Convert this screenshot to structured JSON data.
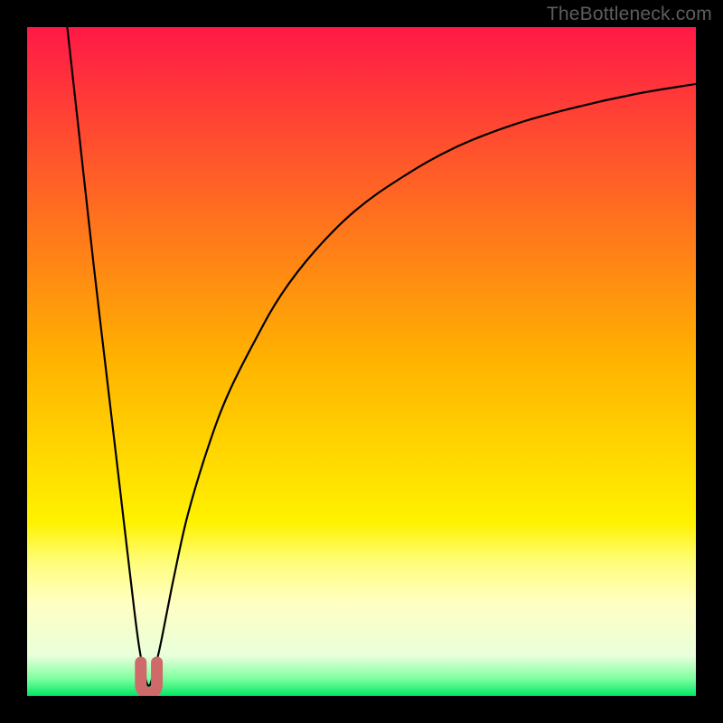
{
  "watermark": "TheBottleneck.com",
  "chart_data": {
    "type": "line",
    "title": "",
    "xlabel": "",
    "ylabel": "",
    "xlim": [
      0,
      100
    ],
    "ylim": [
      0,
      100
    ],
    "grid": false,
    "legend": false,
    "background_gradient": {
      "stops": [
        {
          "offset": 0.0,
          "color": "#ff1947"
        },
        {
          "offset": 0.5,
          "color": "#ffb300"
        },
        {
          "offset": 0.74,
          "color": "#fff200"
        },
        {
          "offset": 0.8,
          "color": "#fffd7a"
        },
        {
          "offset": 0.86,
          "color": "#ffffc2"
        },
        {
          "offset": 0.94,
          "color": "#e9ffdb"
        },
        {
          "offset": 0.975,
          "color": "#7bff9e"
        },
        {
          "offset": 1.0,
          "color": "#00e763"
        }
      ]
    },
    "series": [
      {
        "name": "curve",
        "type": "line",
        "x": [
          6.0,
          8.0,
          10.0,
          12.0,
          14.0,
          16.0,
          16.8,
          17.6,
          18.2,
          18.8,
          19.8,
          21.0,
          22.0,
          24.0,
          27.0,
          30.0,
          34.0,
          38.0,
          43.0,
          49.0,
          56.0,
          64.0,
          73.0,
          82.0,
          91.0,
          100.0
        ],
        "y": [
          100.0,
          82.0,
          64.0,
          47.0,
          30.0,
          13.0,
          7.0,
          3.0,
          1.5,
          3.0,
          7.0,
          13.0,
          18.0,
          27.0,
          37.0,
          45.0,
          53.0,
          60.0,
          66.5,
          72.5,
          77.5,
          82.0,
          85.5,
          88.0,
          90.0,
          91.5
        ]
      },
      {
        "name": "minimum-marker",
        "type": "marker",
        "shape": "u",
        "color": "#cf6a6a",
        "x": [
          17.0,
          19.4
        ],
        "y": [
          0.5,
          5.0
        ]
      }
    ]
  }
}
